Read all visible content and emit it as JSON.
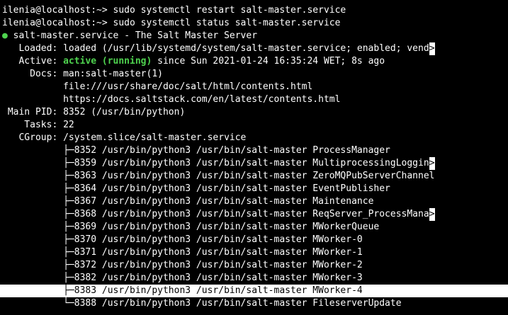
{
  "terminal": {
    "cmd1": "ilenia@localhost:~> sudo systemctl restart salt-master.service",
    "cmd2": "ilenia@localhost:~> sudo systemctl status salt-master.service",
    "bullet": "●",
    "service_title": " salt-master.service - The Salt Master Server",
    "loaded_label": "   Loaded: ",
    "loaded_value": "loaded (/usr/lib/systemd/system/salt-master.service; enabled; vend",
    "overflow": ">",
    "active_label": "   Active: ",
    "active_status": "active (running)",
    "active_rest": " since Sun 2021-01-24 16:35:24 WET; 8s ago",
    "docs_label": "     Docs: ",
    "docs_1": "man:salt-master(1)",
    "docs_2": "           file:///usr/share/doc/salt/html/contents.html",
    "docs_3": "           https://docs.saltstack.com/en/latest/contents.html",
    "mainpid": " Main PID: 8352 (/usr/bin/python)",
    "tasks": "    Tasks: 22",
    "cgroup": "   CGroup: /system.slice/salt-master.service",
    "processes": [
      {
        "prefix": "           ├─",
        "text": "8352 /usr/bin/python3 /usr/bin/salt-master ProcessManager",
        "overflow": false
      },
      {
        "prefix": "           ├─",
        "text": "8359 /usr/bin/python3 /usr/bin/salt-master MultiprocessingLoggin",
        "overflow": true
      },
      {
        "prefix": "           ├─",
        "text": "8363 /usr/bin/python3 /usr/bin/salt-master ZeroMQPubServerChannel",
        "overflow": false
      },
      {
        "prefix": "           ├─",
        "text": "8364 /usr/bin/python3 /usr/bin/salt-master EventPublisher",
        "overflow": false
      },
      {
        "prefix": "           ├─",
        "text": "8367 /usr/bin/python3 /usr/bin/salt-master Maintenance",
        "overflow": false
      },
      {
        "prefix": "           ├─",
        "text": "8368 /usr/bin/python3 /usr/bin/salt-master ReqServer_ProcessMana",
        "overflow": true
      },
      {
        "prefix": "           ├─",
        "text": "8369 /usr/bin/python3 /usr/bin/salt-master MWorkerQueue",
        "overflow": false
      },
      {
        "prefix": "           ├─",
        "text": "8370 /usr/bin/python3 /usr/bin/salt-master MWorker-0",
        "overflow": false
      },
      {
        "prefix": "           ├─",
        "text": "8371 /usr/bin/python3 /usr/bin/salt-master MWorker-1",
        "overflow": false
      },
      {
        "prefix": "           ├─",
        "text": "8372 /usr/bin/python3 /usr/bin/salt-master MWorker-2",
        "overflow": false
      },
      {
        "prefix": "           ├─",
        "text": "8382 /usr/bin/python3 /usr/bin/salt-master MWorker-3",
        "overflow": false
      },
      {
        "prefix": "           ├─",
        "text": "8383 /usr/bin/python3 /usr/bin/salt-master MWorker-4",
        "overflow": false
      },
      {
        "prefix": "           └─",
        "text": "8388 /usr/bin/python3 /usr/bin/salt-master FileserverUpdate",
        "overflow": false
      }
    ]
  },
  "colors": {
    "background": "#000000",
    "foreground": "#ffffff",
    "active_green": "#4fd34f"
  }
}
